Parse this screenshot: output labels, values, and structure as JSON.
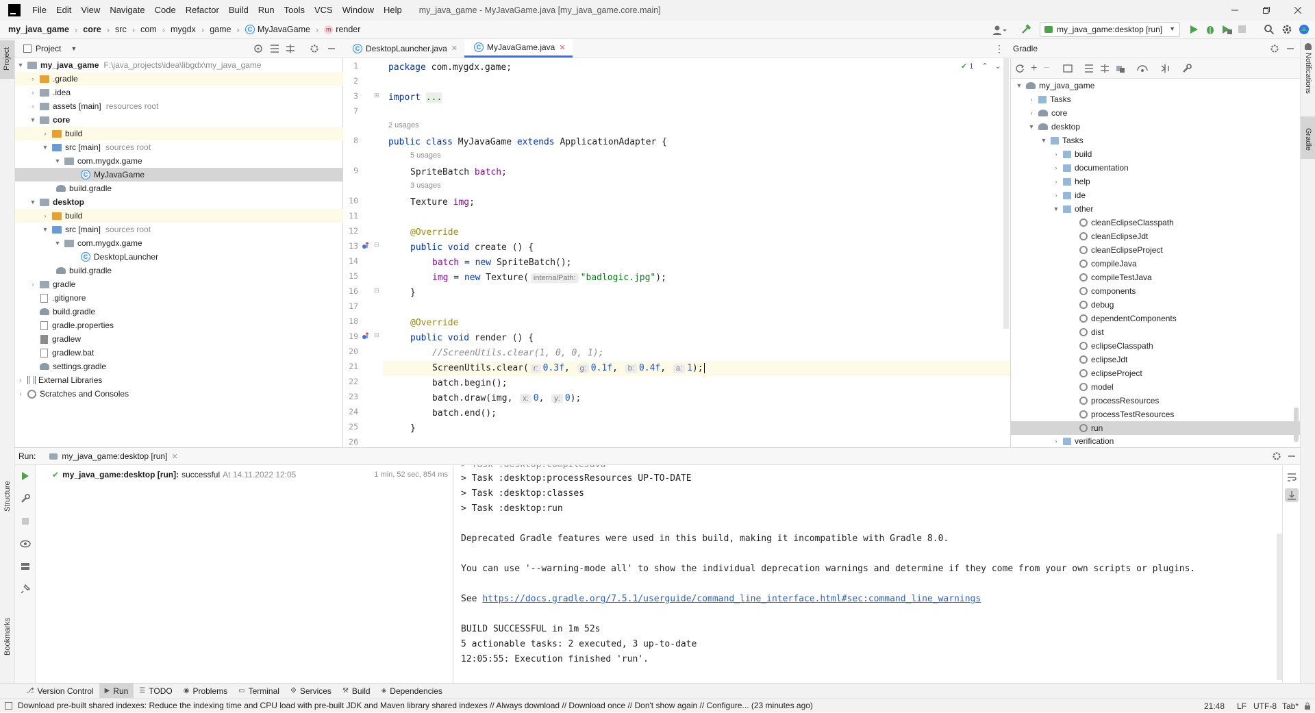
{
  "window": {
    "title": "my_java_game - MyJavaGame.java [my_java_game.core.main]",
    "menu": [
      "File",
      "Edit",
      "View",
      "Navigate",
      "Code",
      "Refactor",
      "Build",
      "Run",
      "Tools",
      "VCS",
      "Window",
      "Help"
    ]
  },
  "breadcrumb": [
    "my_java_game",
    "core",
    "src",
    "com",
    "mygdx",
    "game",
    "MyJavaGame",
    "render"
  ],
  "run_config": "my_java_game:desktop [run]",
  "left_strip": {
    "project": "Project",
    "structure": "Structure",
    "bookmarks": "Bookmarks"
  },
  "right_strip": {
    "notifications": "Notifications",
    "gradle": "Gradle"
  },
  "project_panel": {
    "title": "Project",
    "rows": [
      {
        "label": "my_java_game",
        "hint": "F:\\java_projects\\idea\\libgdx\\my_java_game",
        "bold": true
      },
      {
        "label": ".gradle"
      },
      {
        "label": ".idea"
      },
      {
        "label": "assets [main]",
        "hint": "resources root"
      },
      {
        "label": "core",
        "bold": true
      },
      {
        "label": "build"
      },
      {
        "label": "src [main]",
        "hint": "sources root"
      },
      {
        "label": "com.mygdx.game"
      },
      {
        "label": "MyJavaGame"
      },
      {
        "label": "build.gradle"
      },
      {
        "label": "desktop",
        "bold": true
      },
      {
        "label": "build"
      },
      {
        "label": "src [main]",
        "hint": "sources root"
      },
      {
        "label": "com.mygdx.game"
      },
      {
        "label": "DesktopLauncher"
      },
      {
        "label": "build.gradle"
      },
      {
        "label": "gradle"
      },
      {
        "label": ".gitignore"
      },
      {
        "label": "build.gradle"
      },
      {
        "label": "gradle.properties"
      },
      {
        "label": "gradlew"
      },
      {
        "label": "gradlew.bat"
      },
      {
        "label": "settings.gradle"
      },
      {
        "label": "External Libraries"
      },
      {
        "label": "Scratches and Consoles"
      }
    ]
  },
  "editor": {
    "tabs": [
      "DesktopLauncher.java",
      "MyJavaGame.java"
    ],
    "inspection_count": "1",
    "line_numbers": [
      "1",
      "2",
      "3",
      "7",
      "8",
      "9",
      "10",
      "11",
      "12",
      "13",
      "14",
      "15",
      "16",
      "17",
      "18",
      "19",
      "20",
      "21",
      "22",
      "23",
      "24",
      "25",
      "26"
    ],
    "usages": {
      "class": "2 usages",
      "batch": "5 usages",
      "img": "3 usages"
    },
    "code": {
      "package_kw": "package",
      "package_name": " com.mygdx.game;",
      "import_kw": "import",
      "import_dots": "...",
      "l8_a": "public class ",
      "l8_b": "MyJavaGame ",
      "l8_c": "extends ",
      "l8_d": "ApplicationAdapter {",
      "l9_a": "SpriteBatch ",
      "l9_b": "batch",
      ";": ";",
      "l10_a": "Texture ",
      "l10_b": "img",
      "override": "@Override",
      "l13_a": "public void ",
      "l13_b": "create () {",
      "l14_a": "batch",
      " eq_new": " = new ",
      "l14_b": "SpriteBatch();",
      "l15_a": "img",
      "l15_b": "Texture(",
      "hint_path": "internalPath:",
      "l15_str": "\"badlogic.jpg\"",
      "l15_end": ");",
      "close": "}",
      "l19_b": "render () {",
      "l20": "//ScreenUtils.clear(1, 0, 0, 1);",
      "l21_a": "ScreenUtils.clear(",
      "hint_r": "r:",
      "v_r": "0.3f",
      ",": ",",
      "hint_g": "g:",
      "v_g": "0.1f",
      "hint_b": "b:",
      "v_b": "0.4f",
      "hint_a": "a:",
      "v_a": "1",
      "l21_end": ");",
      "l22": "batch.begin();",
      "l23_a": "batch.draw(img,",
      "hint_x": "x:",
      "v_x": "0",
      "hint_y": "y:",
      "v_y": "0",
      "l23_end": ");",
      "l24": "batch.end();"
    }
  },
  "gradle_panel": {
    "title": "Gradle",
    "rows": [
      "my_java_game",
      "Tasks",
      "core",
      "desktop",
      "Tasks",
      "build",
      "documentation",
      "help",
      "ide",
      "other",
      "cleanEclipseClasspath",
      "cleanEclipseJdt",
      "cleanEclipseProject",
      "compileJava",
      "compileTestJava",
      "components",
      "debug",
      "dependentComponents",
      "dist",
      "eclipseClasspath",
      "eclipseJdt",
      "eclipseProject",
      "model",
      "processResources",
      "processTestResources",
      "run",
      "verification"
    ]
  },
  "run_panel": {
    "label": "Run:",
    "tab": "my_java_game:desktop [run]",
    "result_name": "my_java_game:desktop [run]:",
    "result_status": "successful",
    "result_time": "At 14.11.2022 12:05",
    "duration": "1 min, 52 sec, 854 ms",
    "console": [
      "> Task :desktop:processResources UP-TO-DATE",
      "> Task :desktop:classes",
      "> Task :desktop:run",
      "Deprecated Gradle features were used in this build, making it incompatible with Gradle 8.0.",
      "You can use '--warning-mode all' to show the individual deprecation warnings and determine if they come from your own scripts or plugins.",
      "See ",
      "BUILD SUCCESSFUL in 1m 52s",
      "5 actionable tasks: 2 executed, 3 up-to-date",
      "12:05:55: Execution finished 'run'."
    ],
    "link": "https://docs.gradle.org/7.5.1/userguide/command_line_interface.html#sec:command_line_warnings"
  },
  "tool_windows": [
    "Version Control",
    "Run",
    "TODO",
    "Problems",
    "Terminal",
    "Services",
    "Build",
    "Dependencies"
  ],
  "status_bar": {
    "message": "Download pre-built shared indexes: Reduce the indexing time and CPU load with pre-built JDK and Maven library shared indexes // Always download // Download once // Don't show again // Configure... (23 minutes ago)",
    "position": "21:48",
    "line_sep": "LF",
    "encoding": "UTF-8",
    "indent": "Tab*"
  },
  "colors": {
    "accent": "#3574f0",
    "keyword": "#0033b3",
    "field": "#871094",
    "string": "#067d17",
    "annotation": "#9e880d",
    "number": "#1750eb",
    "success": "#4aa34a"
  }
}
